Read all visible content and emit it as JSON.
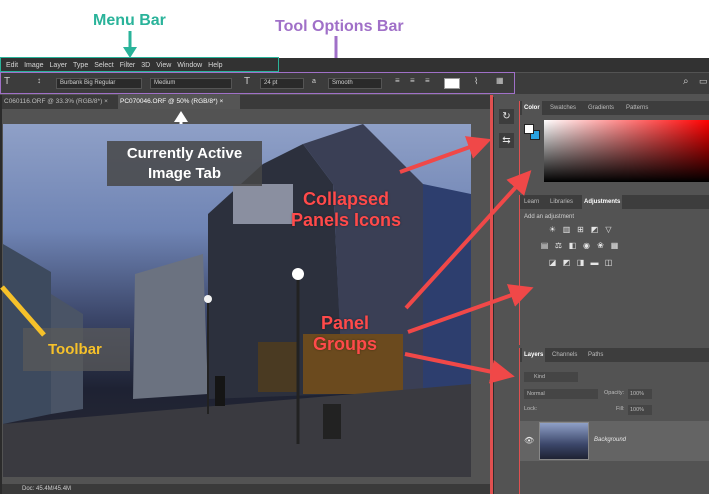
{
  "annotations": {
    "menu_bar": "Menu Bar",
    "tool_options_bar": "Tool Options Bar",
    "currently_active_tab": "Currently Active Image Tab",
    "collapsed_panels_icons": "Collapsed Panels Icons",
    "panel_groups": "Panel Groups",
    "toolbar": "Toolbar"
  },
  "menu": {
    "items": [
      "Edit",
      "Image",
      "Layer",
      "Type",
      "Select",
      "Filter",
      "3D",
      "View",
      "Window",
      "Help"
    ]
  },
  "tool_options": {
    "font_family": "Burbank Big Regular",
    "font_style": "Medium",
    "font_size": "24 pt",
    "antialias": "Smooth"
  },
  "documents": {
    "tabs": [
      {
        "label": "C060116.ORF @ 33.3% (RGB/8*)"
      },
      {
        "label": "PC070046.ORF @ 50% (RGB/8*)"
      }
    ]
  },
  "panels": {
    "color_group": {
      "tabs": [
        "Color",
        "Swatches",
        "Gradients",
        "Patterns"
      ],
      "active": "Color"
    },
    "adjust_group": {
      "tabs": [
        "Learn",
        "Libraries",
        "Adjustments"
      ],
      "active": "Adjustments",
      "hint": "Add an adjustment"
    },
    "layers_group": {
      "tabs": [
        "Layers",
        "Channels",
        "Paths"
      ],
      "active": "Layers"
    },
    "layers": {
      "kind_label": "Kind",
      "blend_mode": "Normal",
      "opacity_label": "Opacity:",
      "opacity_value": "100%",
      "lock_label": "Lock:",
      "fill_label": "Fill:",
      "fill_value": "100%",
      "layer_name": "Background"
    }
  },
  "status": {
    "text": "Doc: 45.4M/45.4M"
  },
  "colors": {
    "accent_menu": "#2ab39a",
    "accent_options": "#a070c8",
    "accent_red": "#e05050",
    "fg_color": "#ffffff",
    "bg_color": "#29a1e0"
  }
}
